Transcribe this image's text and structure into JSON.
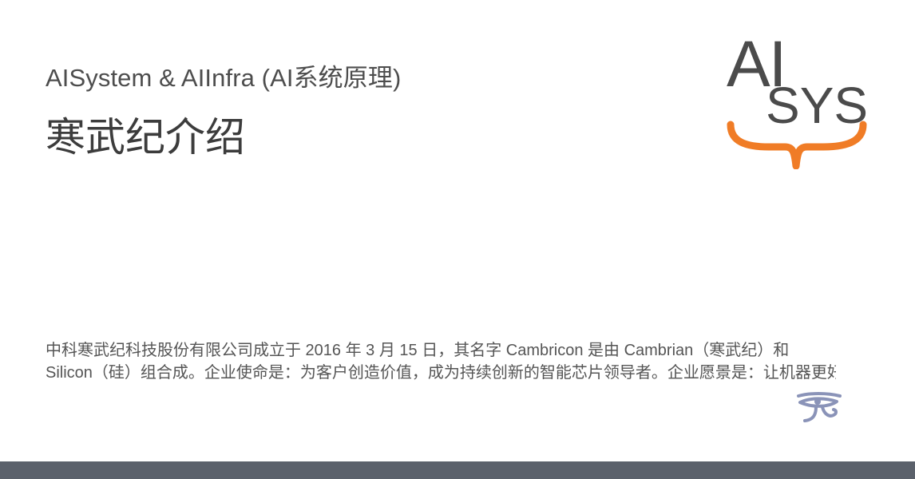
{
  "header": {
    "site_title": "AISystem & AIInfra (AI系统原理)",
    "page_title": "寒武纪介绍"
  },
  "logo": {
    "line1": "AI",
    "line2": "SYS",
    "colors": {
      "text": "#4b4b4b",
      "brace": "#f07c26"
    }
  },
  "description": {
    "line1": "中科寒武纪科技股份有限公司成立于 2016 年 3 月 15 日，其名字 Cambricon 是由 Cambrian（寒武纪）和",
    "line2": "Silicon（硅）组合成。企业使命是：为客户创造价值，成为持续创新的智能芯片领导者。企业愿景是：让机器更好地理解和服务人类。寒武纪提供..."
  },
  "footer_icon": {
    "name": "eye-of-horus-icon",
    "color": "#8a93b8"
  },
  "theme": {
    "footer_bar": "#5b616b",
    "background": "#ffffff"
  }
}
